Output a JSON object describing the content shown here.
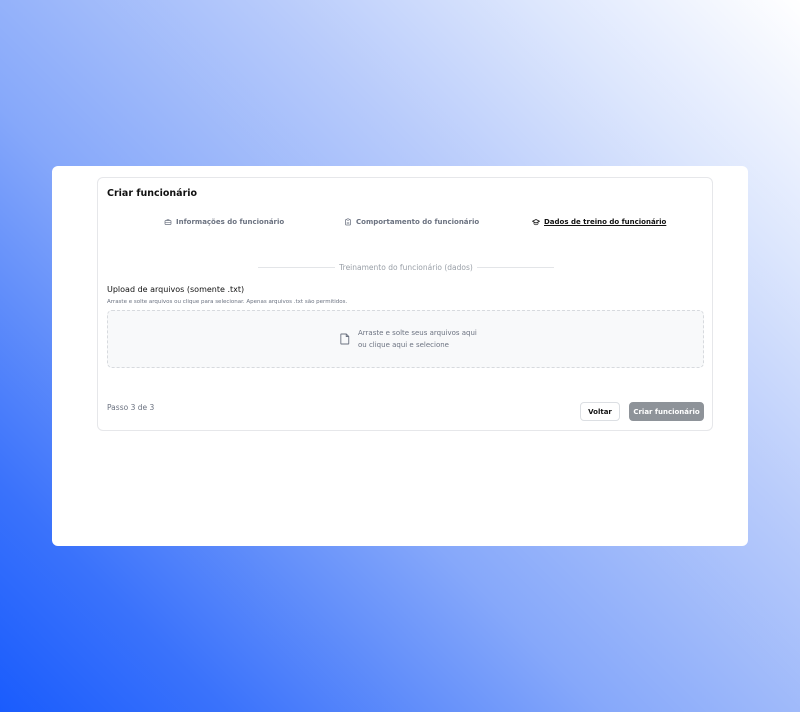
{
  "form": {
    "title": "Criar funcionário",
    "tabs": [
      {
        "label": "Informações do funcionário",
        "icon": "briefcase-icon",
        "active": false
      },
      {
        "label": "Comportamento do funcionário",
        "icon": "clipboard-icon",
        "active": false
      },
      {
        "label": "Dados de treino do funcionário",
        "icon": "graduation-cap-icon",
        "active": true
      }
    ],
    "section_label": "Treinamento do funcionário (dados)",
    "upload": {
      "title": "Upload de arquivos (somente .txt)",
      "help": "Arraste e solte arquivos ou clique para selecionar. Apenas arquivos .txt são permitidos.",
      "drop_line1": "Arraste e solte seus arquivos aqui",
      "drop_line2": "ou clique aqui e selecione",
      "icon": "file-icon"
    },
    "step_text": "Passo 3 de 3",
    "back_label": "Voltar",
    "create_label": "Criar funcionário"
  },
  "colors": {
    "background_gradient_start": "#1a5cfd",
    "background_gradient_end": "#ffffff",
    "primary_disabled": "#8e9399"
  }
}
